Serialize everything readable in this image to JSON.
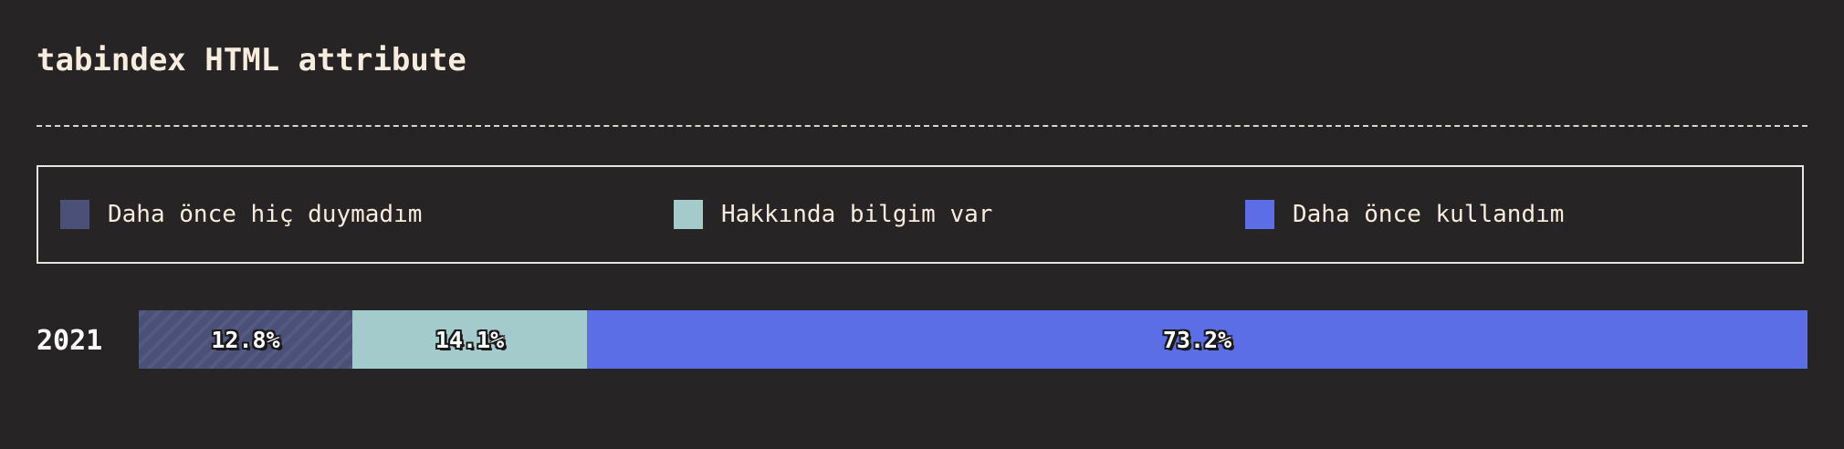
{
  "chart_data": {
    "type": "bar",
    "orientation": "horizontal",
    "stacked": true,
    "normalized_percent": true,
    "title": "tabindex HTML attribute",
    "categories": [
      "2021"
    ],
    "series": [
      {
        "name": "Daha önce hiç duymadım",
        "values": [
          12.8
        ],
        "label": "12.8%",
        "color": "#4a5078",
        "pattern": "diagonal-hatch"
      },
      {
        "name": "Hakkında bilgim var",
        "values": [
          14.1
        ],
        "label": "14.1%",
        "color": "#a3cbcc"
      },
      {
        "name": "Daha önce kullandım",
        "values": [
          73.2
        ],
        "label": "73.2%",
        "color": "#5b6ee6"
      }
    ],
    "legend_position": "top",
    "grid": false
  }
}
